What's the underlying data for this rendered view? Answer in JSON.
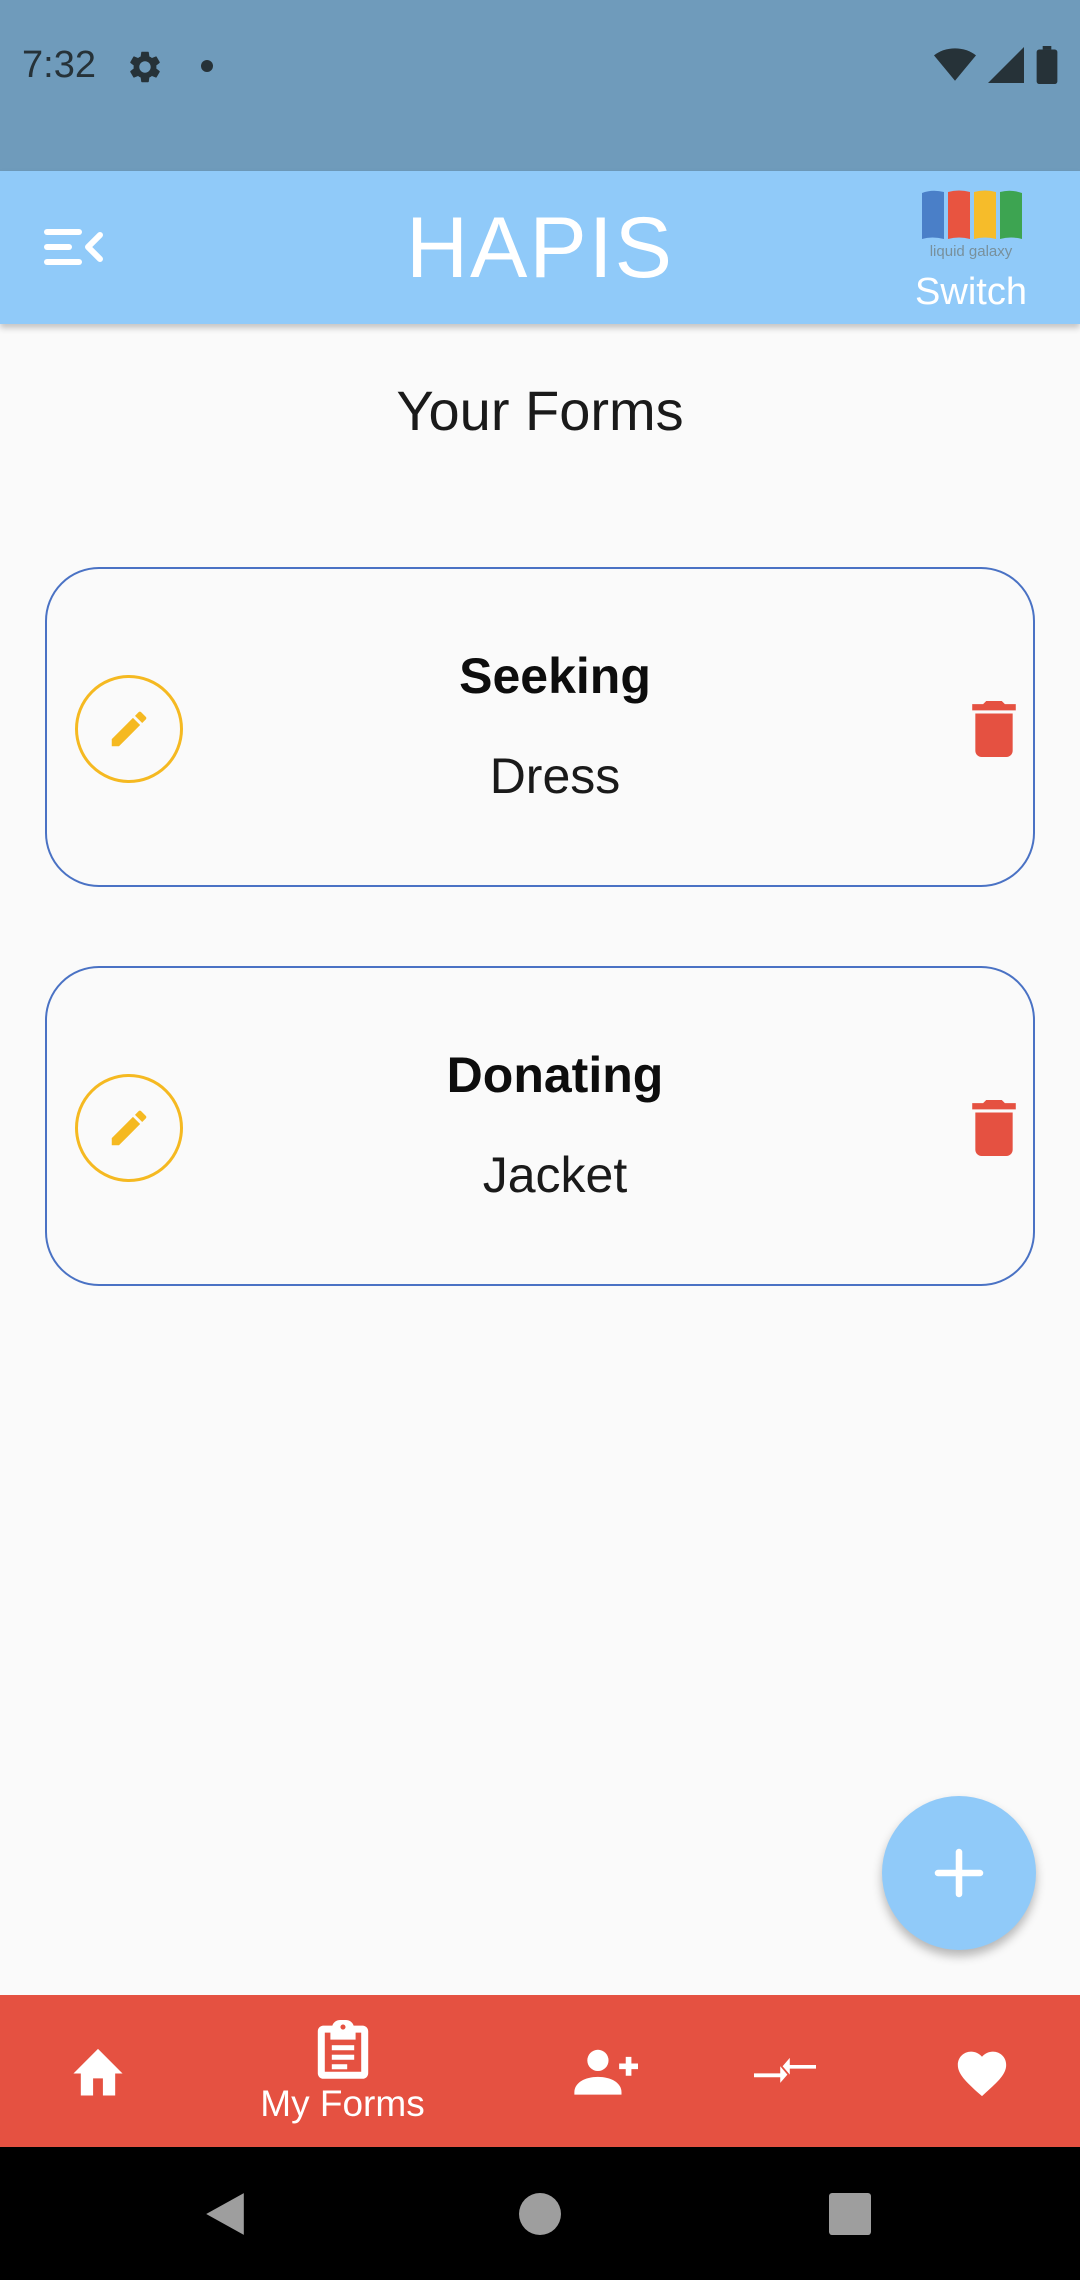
{
  "status_bar": {
    "time": "7:32",
    "icons": [
      "settings-icon",
      "notification-dot",
      "wifi-icon",
      "signal-icon",
      "battery-icon"
    ]
  },
  "app_bar": {
    "title": "HAPIS",
    "logo_text": "liquid galaxy",
    "switch_label": "Switch",
    "logo_colors": [
      "#4a7fc8",
      "#e85440",
      "#f6bc2a",
      "#3da451"
    ]
  },
  "page": {
    "title": "Your Forms"
  },
  "forms": [
    {
      "type": "Seeking",
      "item": "Dress"
    },
    {
      "type": "Donating",
      "item": "Jacket"
    }
  ],
  "bottom_nav": {
    "items": [
      {
        "icon": "home-icon",
        "label": ""
      },
      {
        "icon": "clipboard-icon",
        "label": "My Forms"
      },
      {
        "icon": "add-person-icon",
        "label": ""
      },
      {
        "icon": "compress-icon",
        "label": ""
      },
      {
        "icon": "heart-icon",
        "label": ""
      }
    ],
    "active_index": 1
  },
  "colors": {
    "status_bar": "#6f9bbb",
    "app_bar": "#90caf9",
    "bottom_nav": "#e55141",
    "card_border": "#4a72c4",
    "edit_accent": "#f5b921",
    "delete_accent": "#e55141"
  }
}
